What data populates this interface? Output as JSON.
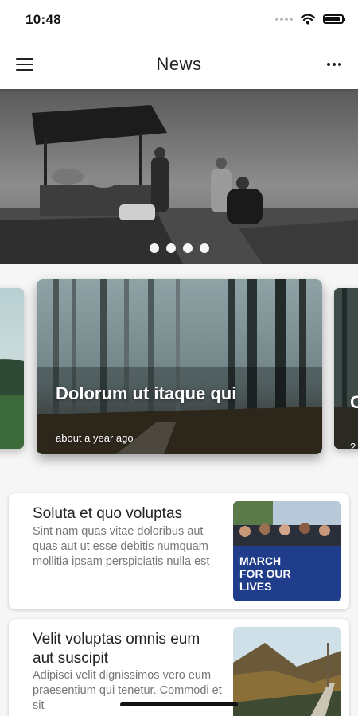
{
  "status_bar": {
    "time": "10:48"
  },
  "app_bar": {
    "title": "News"
  },
  "hero": {
    "slide_count": 4,
    "active_slide": 1
  },
  "featured": [
    {
      "title": "",
      "meta": ""
    },
    {
      "title": "Dolorum ut itaque qui",
      "meta": "about a year ago"
    },
    {
      "title": "C",
      "meta": "2"
    }
  ],
  "articles": [
    {
      "title": "Soluta et quo voluptas",
      "excerpt": "Sint nam quas vitae doloribus aut quas aut ut esse debitis numquam mollitia ipsam perspiciatis nulla est",
      "thumb_icon": "march-for-our-lives-photo",
      "thumb_text": "MARCH FOR OUR LIVES"
    },
    {
      "title": "Velit voluptas omnis eum aut suscipit",
      "excerpt": "Adipisci velit dignissimos vero eum praesentium qui tenetur. Commodi et sit",
      "thumb_icon": "mountain-road-photo"
    }
  ],
  "colors": {
    "accent": "#222222",
    "card_bg": "#ffffff",
    "list_bg": "#f6f6f6",
    "excerpt": "#777777"
  }
}
